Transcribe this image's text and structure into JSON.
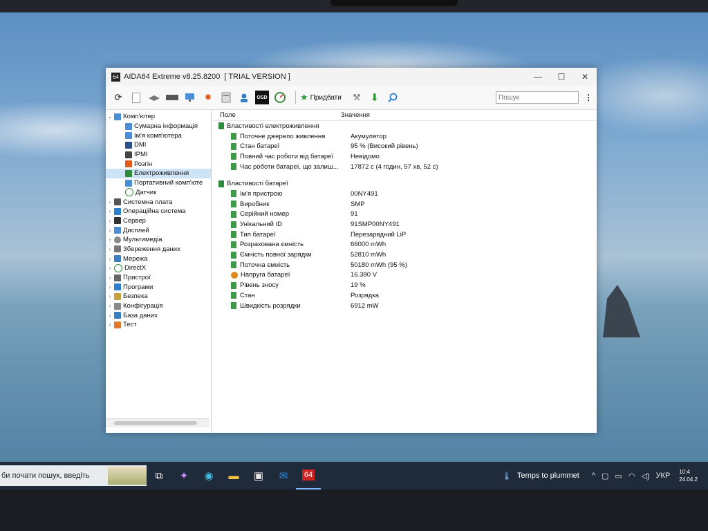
{
  "window": {
    "title": "AIDA64 Extreme v8.25.8200",
    "version_tag": "[ TRIAL VERSION ]",
    "app_icon_text": "64",
    "controls": [
      "—",
      "☐",
      "✕"
    ]
  },
  "toolbar": {
    "add_label": "Придбати",
    "osd_label": "OSD",
    "search_placeholder": "Пошук"
  },
  "tree": {
    "root": "Комп'ютер",
    "children": [
      "Сумарна інформація",
      "Ім'я комп'ютера",
      "DMI",
      "IPMI",
      "Розгін",
      "Електроживлення",
      "Портативний комп'юте",
      "Датчик"
    ],
    "selected": "Електроживлення",
    "sections": [
      "Системна плата",
      "Операційна система",
      "Сервер",
      "Дисплей",
      "Мультимедіа",
      "Збереження даних",
      "Мережа",
      "DirectX",
      "Пристрої",
      "Програми",
      "Безпека",
      "Конфігурація",
      "База даних",
      "Тест"
    ]
  },
  "table": {
    "col_field": "Поле",
    "col_value": "Значення",
    "group1": {
      "title": "Властивості електроживлення",
      "rows": [
        {
          "field": "Поточне джерело живлення",
          "value": "Акумулятор"
        },
        {
          "field": "Стан батареї",
          "value": "95 % (Високий рівень)"
        },
        {
          "field": "Повний час роботи від батареї",
          "value": "Невідомо"
        },
        {
          "field": "Час роботи батареї, що залиш...",
          "value": "17872 с (4 годин, 57 хв, 52 с)"
        }
      ]
    },
    "group2": {
      "title": "Властивості батареї",
      "rows": [
        {
          "field": "Ім'я пристрою",
          "value": "00NY491"
        },
        {
          "field": "Виробник",
          "value": "SMP"
        },
        {
          "field": "Серійний номер",
          "value": "91"
        },
        {
          "field": "Унікальний ID",
          "value": "91SMP00NY491"
        },
        {
          "field": "Тип батареї",
          "value": "Перезарядний LiP"
        },
        {
          "field": "Розрахована ємність",
          "value": "66000 mWh"
        },
        {
          "field": "Ємність повної зарядки",
          "value": "52810 mWh"
        },
        {
          "field": "Поточна ємність",
          "value": "50180 mWh  (95 %)"
        },
        {
          "field": "Напруга батареї",
          "value": "16.380 V"
        },
        {
          "field": "Рівень зносу",
          "value": "19 %"
        },
        {
          "field": "Стан",
          "value": "Розрядка"
        },
        {
          "field": "Швидкість розрядки",
          "value": "6912 mW"
        }
      ]
    }
  },
  "taskbar": {
    "search_text": "би почати пошук, введіть",
    "weather": "Temps to plummet",
    "language": "УКР",
    "time": "10:4",
    "date": "24.04.2"
  }
}
